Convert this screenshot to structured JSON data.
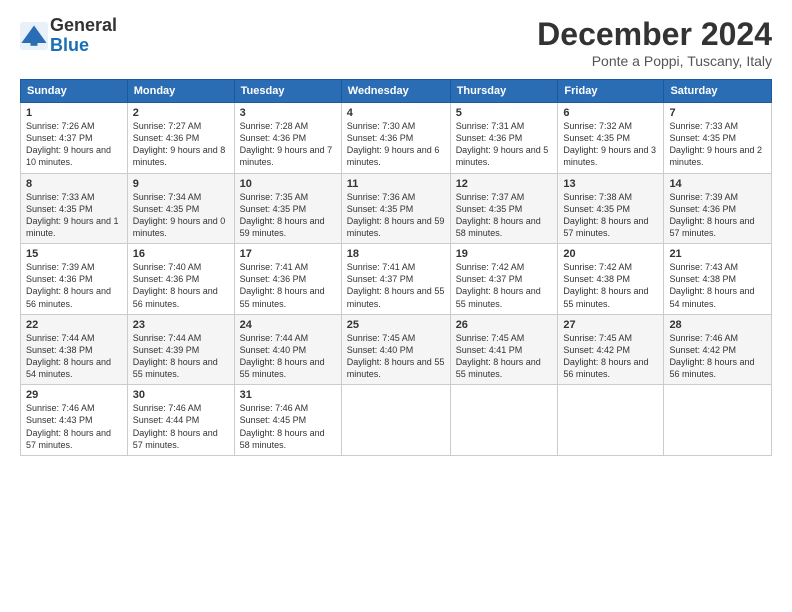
{
  "header": {
    "logo_line1": "General",
    "logo_line2": "Blue",
    "month": "December 2024",
    "location": "Ponte a Poppi, Tuscany, Italy"
  },
  "days_of_week": [
    "Sunday",
    "Monday",
    "Tuesday",
    "Wednesday",
    "Thursday",
    "Friday",
    "Saturday"
  ],
  "weeks": [
    [
      {
        "day": "1",
        "sunrise": "7:26 AM",
        "sunset": "4:37 PM",
        "daylight": "9 hours and 10 minutes."
      },
      {
        "day": "2",
        "sunrise": "7:27 AM",
        "sunset": "4:36 PM",
        "daylight": "9 hours and 8 minutes."
      },
      {
        "day": "3",
        "sunrise": "7:28 AM",
        "sunset": "4:36 PM",
        "daylight": "9 hours and 7 minutes."
      },
      {
        "day": "4",
        "sunrise": "7:30 AM",
        "sunset": "4:36 PM",
        "daylight": "9 hours and 6 minutes."
      },
      {
        "day": "5",
        "sunrise": "7:31 AM",
        "sunset": "4:36 PM",
        "daylight": "9 hours and 5 minutes."
      },
      {
        "day": "6",
        "sunrise": "7:32 AM",
        "sunset": "4:35 PM",
        "daylight": "9 hours and 3 minutes."
      },
      {
        "day": "7",
        "sunrise": "7:33 AM",
        "sunset": "4:35 PM",
        "daylight": "9 hours and 2 minutes."
      }
    ],
    [
      {
        "day": "8",
        "sunrise": "7:33 AM",
        "sunset": "4:35 PM",
        "daylight": "9 hours and 1 minute."
      },
      {
        "day": "9",
        "sunrise": "7:34 AM",
        "sunset": "4:35 PM",
        "daylight": "9 hours and 0 minutes."
      },
      {
        "day": "10",
        "sunrise": "7:35 AM",
        "sunset": "4:35 PM",
        "daylight": "8 hours and 59 minutes."
      },
      {
        "day": "11",
        "sunrise": "7:36 AM",
        "sunset": "4:35 PM",
        "daylight": "8 hours and 59 minutes."
      },
      {
        "day": "12",
        "sunrise": "7:37 AM",
        "sunset": "4:35 PM",
        "daylight": "8 hours and 58 minutes."
      },
      {
        "day": "13",
        "sunrise": "7:38 AM",
        "sunset": "4:35 PM",
        "daylight": "8 hours and 57 minutes."
      },
      {
        "day": "14",
        "sunrise": "7:39 AM",
        "sunset": "4:36 PM",
        "daylight": "8 hours and 57 minutes."
      }
    ],
    [
      {
        "day": "15",
        "sunrise": "7:39 AM",
        "sunset": "4:36 PM",
        "daylight": "8 hours and 56 minutes."
      },
      {
        "day": "16",
        "sunrise": "7:40 AM",
        "sunset": "4:36 PM",
        "daylight": "8 hours and 56 minutes."
      },
      {
        "day": "17",
        "sunrise": "7:41 AM",
        "sunset": "4:36 PM",
        "daylight": "8 hours and 55 minutes."
      },
      {
        "day": "18",
        "sunrise": "7:41 AM",
        "sunset": "4:37 PM",
        "daylight": "8 hours and 55 minutes."
      },
      {
        "day": "19",
        "sunrise": "7:42 AM",
        "sunset": "4:37 PM",
        "daylight": "8 hours and 55 minutes."
      },
      {
        "day": "20",
        "sunrise": "7:42 AM",
        "sunset": "4:38 PM",
        "daylight": "8 hours and 55 minutes."
      },
      {
        "day": "21",
        "sunrise": "7:43 AM",
        "sunset": "4:38 PM",
        "daylight": "8 hours and 54 minutes."
      }
    ],
    [
      {
        "day": "22",
        "sunrise": "7:44 AM",
        "sunset": "4:38 PM",
        "daylight": "8 hours and 54 minutes."
      },
      {
        "day": "23",
        "sunrise": "7:44 AM",
        "sunset": "4:39 PM",
        "daylight": "8 hours and 55 minutes."
      },
      {
        "day": "24",
        "sunrise": "7:44 AM",
        "sunset": "4:40 PM",
        "daylight": "8 hours and 55 minutes."
      },
      {
        "day": "25",
        "sunrise": "7:45 AM",
        "sunset": "4:40 PM",
        "daylight": "8 hours and 55 minutes."
      },
      {
        "day": "26",
        "sunrise": "7:45 AM",
        "sunset": "4:41 PM",
        "daylight": "8 hours and 55 minutes."
      },
      {
        "day": "27",
        "sunrise": "7:45 AM",
        "sunset": "4:42 PM",
        "daylight": "8 hours and 56 minutes."
      },
      {
        "day": "28",
        "sunrise": "7:46 AM",
        "sunset": "4:42 PM",
        "daylight": "8 hours and 56 minutes."
      }
    ],
    [
      {
        "day": "29",
        "sunrise": "7:46 AM",
        "sunset": "4:43 PM",
        "daylight": "8 hours and 57 minutes."
      },
      {
        "day": "30",
        "sunrise": "7:46 AM",
        "sunset": "4:44 PM",
        "daylight": "8 hours and 57 minutes."
      },
      {
        "day": "31",
        "sunrise": "7:46 AM",
        "sunset": "4:45 PM",
        "daylight": "8 hours and 58 minutes."
      },
      null,
      null,
      null,
      null
    ]
  ]
}
